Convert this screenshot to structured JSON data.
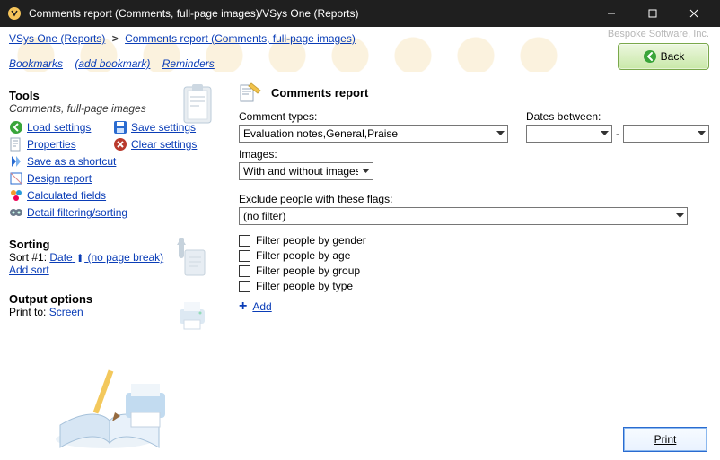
{
  "window": {
    "title": "Comments report (Comments, full-page images)/VSys One (Reports)"
  },
  "brand": "Bespoke Software, Inc.",
  "breadcrumb": {
    "item1": "VSys One (Reports)",
    "sep": ">",
    "item2": "Comments report (Comments, full-page images)"
  },
  "back_label": "Back",
  "secondary_nav": {
    "bookmarks": "Bookmarks",
    "add_bookmark": "(add bookmark)",
    "reminders": "Reminders"
  },
  "sidebar": {
    "tools_title": "Tools",
    "subtitle": "Comments, full-page images",
    "load_settings": "Load settings",
    "save_settings": "Save settings",
    "properties": "Properties",
    "clear_settings": "Clear settings",
    "save_as_shortcut": "Save as a shortcut",
    "design_report": "Design report",
    "calculated_fields": "Calculated fields",
    "detail_filtering": "Detail filtering/sorting",
    "sorting_title": "Sorting",
    "sort_line_prefix": "Sort #1: ",
    "sort_field": "Date",
    "sort_suffix": " (no page break)",
    "add_sort": "Add sort",
    "output_title": "Output options",
    "print_to_label": "Print to: ",
    "print_to_value": "Screen"
  },
  "panel": {
    "title": "Comments report",
    "comment_types_label": "Comment types:",
    "comment_types_value": "Evaluation notes,General,Praise",
    "dates_between_label": "Dates between:",
    "dates_sep": "-",
    "images_label": "Images:",
    "images_value": "With and without images",
    "exclude_label": "Exclude people with these flags:",
    "exclude_value": "(no filter)",
    "filters": {
      "gender": "Filter people by gender",
      "age": "Filter people by age",
      "group": "Filter people by group",
      "type": "Filter people by type"
    },
    "add_label": "Add"
  },
  "footer": {
    "print": "Print"
  }
}
